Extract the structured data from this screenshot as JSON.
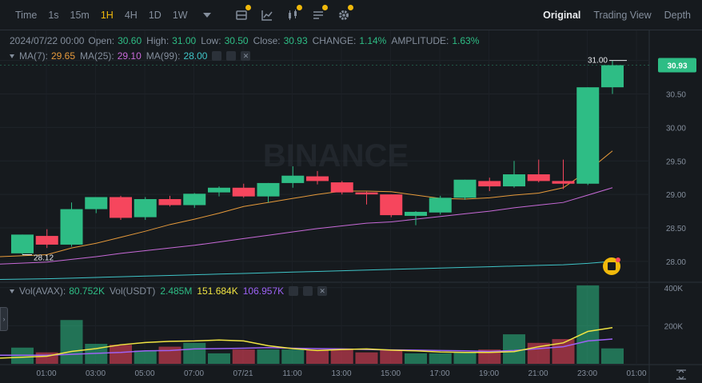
{
  "toolbar": {
    "intervals": [
      "Time",
      "1s",
      "15m",
      "1H",
      "4H",
      "1D",
      "1W"
    ],
    "active_interval": "1H",
    "views": [
      "Original",
      "Trading View",
      "Depth"
    ],
    "active_view": "Original"
  },
  "ohlc": {
    "date": "2024/07/22 00:00",
    "open_label": "Open:",
    "open": "30.60",
    "high_label": "High:",
    "high": "31.00",
    "low_label": "Low:",
    "low": "30.50",
    "close_label": "Close:",
    "close": "30.93",
    "change_label": "CHANGE:",
    "change": "1.14%",
    "amplitude_label": "AMPLITUDE:",
    "amplitude": "1.63%"
  },
  "ma": {
    "ma7_label": "MA(7):",
    "ma7": "29.65",
    "ma25_label": "MA(25):",
    "ma25": "29.10",
    "ma99_label": "MA(99):",
    "ma99": "28.00"
  },
  "vol": {
    "avax_label": "Vol(AVAX):",
    "avax": "80.752K",
    "usdt_label": "Vol(USDT)",
    "usdt": "2.485M",
    "ma1": "151.684K",
    "ma2": "106.957K"
  },
  "watermark": "BINANCE",
  "colors": {
    "up": "#2ebd85",
    "down": "#f6465d",
    "ma7": "#e69a3b",
    "ma25": "#c86ad8",
    "ma99": "#3fc4c7",
    "vma5": "#f0e442",
    "vma10": "#9d62f5",
    "accent": "#f0b90b"
  },
  "chart_data": {
    "type": "candlestick",
    "price_axis": {
      "ticks": [
        "31.00",
        "30.50",
        "30.00",
        "29.50",
        "29.00",
        "28.50",
        "28.00"
      ],
      "range": [
        27.7,
        31.45
      ]
    },
    "volume_axis": {
      "ticks": [
        "400K",
        "200K"
      ],
      "range": [
        0,
        420
      ]
    },
    "x_ticks": [
      "01:00",
      "03:00",
      "05:00",
      "07:00",
      "07/21",
      "11:00",
      "13:00",
      "15:00",
      "17:00",
      "19:00",
      "21:00",
      "23:00",
      "01:00"
    ],
    "current_price_label": "30.93",
    "high_label": "31.00",
    "low_label": "28.12",
    "candles": [
      {
        "o": 28.12,
        "h": 28.4,
        "l": 28.1,
        "c": 28.4,
        "v": 85
      },
      {
        "o": 28.38,
        "h": 28.48,
        "l": 28.2,
        "c": 28.25,
        "v": 60
      },
      {
        "o": 28.25,
        "h": 28.88,
        "l": 28.22,
        "c": 28.78,
        "v": 230
      },
      {
        "o": 28.78,
        "h": 28.96,
        "l": 28.72,
        "c": 28.96,
        "v": 105
      },
      {
        "o": 28.96,
        "h": 28.98,
        "l": 28.62,
        "c": 28.65,
        "v": 100
      },
      {
        "o": 28.66,
        "h": 28.96,
        "l": 28.62,
        "c": 28.93,
        "v": 70
      },
      {
        "o": 28.93,
        "h": 28.98,
        "l": 28.82,
        "c": 28.84,
        "v": 90
      },
      {
        "o": 28.84,
        "h": 29.02,
        "l": 28.8,
        "c": 29.01,
        "v": 110
      },
      {
        "o": 29.03,
        "h": 29.12,
        "l": 28.97,
        "c": 29.1,
        "v": 55
      },
      {
        "o": 29.1,
        "h": 29.16,
        "l": 28.95,
        "c": 28.97,
        "v": 75
      },
      {
        "o": 28.97,
        "h": 29.17,
        "l": 28.88,
        "c": 29.17,
        "v": 75
      },
      {
        "o": 29.17,
        "h": 29.42,
        "l": 29.1,
        "c": 29.28,
        "v": 75
      },
      {
        "o": 29.27,
        "h": 29.35,
        "l": 29.15,
        "c": 29.2,
        "v": 75
      },
      {
        "o": 29.18,
        "h": 29.2,
        "l": 29.0,
        "c": 29.03,
        "v": 75
      },
      {
        "o": 29.03,
        "h": 29.04,
        "l": 28.85,
        "c": 29.0,
        "v": 60
      },
      {
        "o": 29.0,
        "h": 29.0,
        "l": 28.66,
        "c": 28.69,
        "v": 75
      },
      {
        "o": 28.68,
        "h": 28.75,
        "l": 28.54,
        "c": 28.74,
        "v": 55
      },
      {
        "o": 28.73,
        "h": 28.98,
        "l": 28.7,
        "c": 28.95,
        "v": 55
      },
      {
        "o": 28.95,
        "h": 29.22,
        "l": 28.92,
        "c": 29.22,
        "v": 60
      },
      {
        "o": 29.2,
        "h": 29.25,
        "l": 29.05,
        "c": 29.12,
        "v": 75
      },
      {
        "o": 29.12,
        "h": 29.5,
        "l": 29.1,
        "c": 29.3,
        "v": 155
      },
      {
        "o": 29.3,
        "h": 29.52,
        "l": 29.18,
        "c": 29.2,
        "v": 110
      },
      {
        "o": 29.2,
        "h": 29.52,
        "l": 29.08,
        "c": 29.16,
        "v": 130
      },
      {
        "o": 29.16,
        "h": 30.6,
        "l": 29.14,
        "c": 30.6,
        "v": 412
      },
      {
        "o": 30.6,
        "h": 31.0,
        "l": 30.5,
        "c": 30.93,
        "v": 81
      }
    ],
    "ma7": [
      28.07,
      28.1,
      28.2,
      28.27,
      28.36,
      28.45,
      28.55,
      28.63,
      28.72,
      28.82,
      28.88,
      28.94,
      29.0,
      29.05,
      29.05,
      29.04,
      28.99,
      28.94,
      28.93,
      28.95,
      28.99,
      29.02,
      29.1,
      29.35,
      29.65
    ],
    "ma25": [
      27.96,
      27.99,
      28.03,
      28.07,
      28.12,
      28.16,
      28.2,
      28.24,
      28.29,
      28.34,
      28.39,
      28.44,
      28.49,
      28.53,
      28.57,
      28.59,
      28.63,
      28.67,
      28.71,
      28.75,
      28.8,
      28.84,
      28.88,
      28.99,
      29.1
    ],
    "ma99": [
      27.73,
      27.74,
      27.75,
      27.76,
      27.77,
      27.78,
      27.79,
      27.8,
      27.81,
      27.82,
      27.83,
      27.84,
      27.85,
      27.86,
      27.87,
      27.88,
      27.89,
      27.9,
      27.91,
      27.92,
      27.93,
      27.94,
      27.95,
      27.97,
      28.0
    ],
    "vma5": [
      30,
      40,
      65,
      80,
      100,
      112,
      118,
      120,
      125,
      120,
      95,
      80,
      70,
      75,
      78,
      72,
      68,
      62,
      60,
      60,
      64,
      90,
      110,
      170,
      190
    ],
    "vma10": [
      45,
      45,
      50,
      55,
      60,
      68,
      70,
      78,
      80,
      82,
      85,
      82,
      80,
      78,
      75,
      73,
      72,
      70,
      68,
      65,
      70,
      80,
      90,
      120,
      130
    ]
  }
}
